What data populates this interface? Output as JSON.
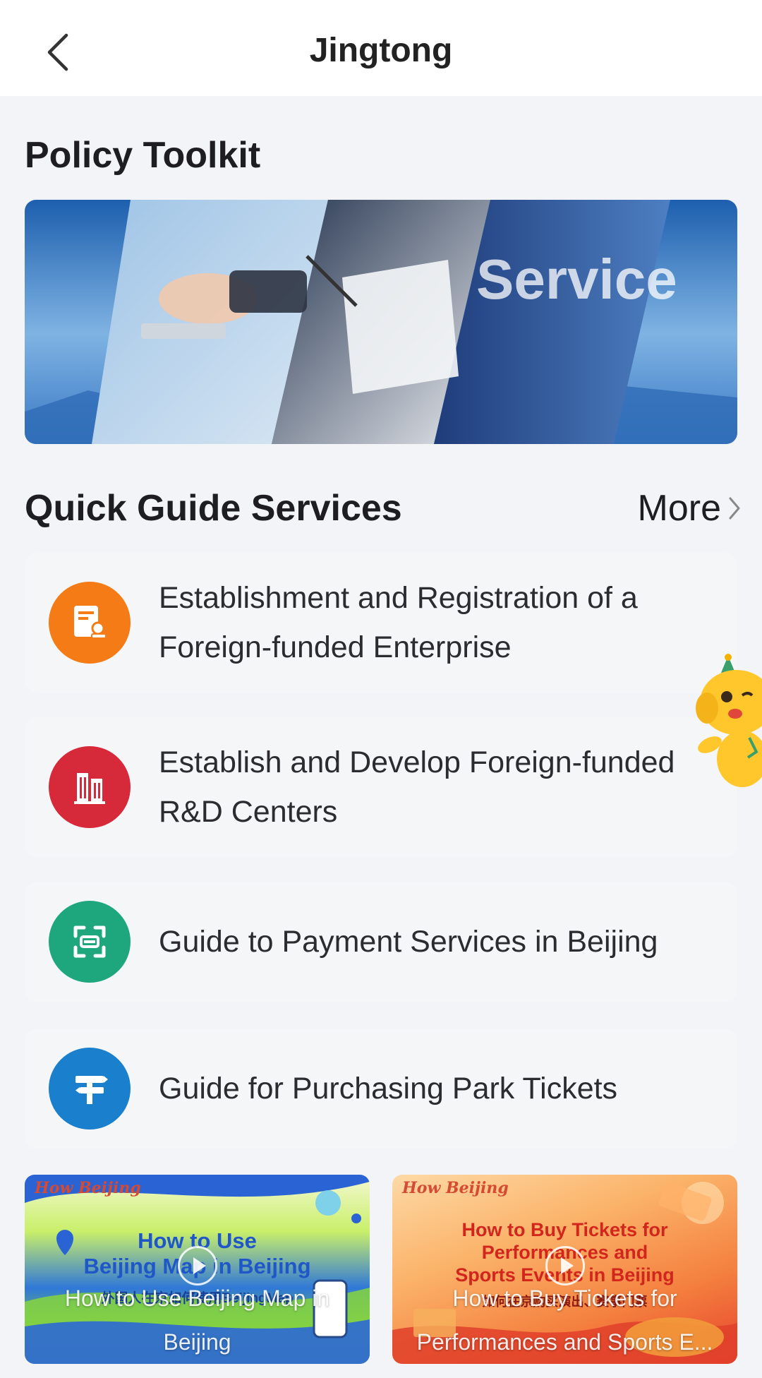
{
  "header": {
    "title": "Jingtong",
    "back_icon": "chevron-left-icon"
  },
  "policy_toolkit": {
    "title": "Policy Toolkit",
    "banner_text": "Service"
  },
  "quick_guide": {
    "title": "Quick Guide Services",
    "more_label": "More",
    "items": [
      {
        "label": "Establishment and Registration of a Foreign-funded Enterprise",
        "icon": "registration-stamp-icon",
        "color": "#f47b16"
      },
      {
        "label": "Establish and Develop Foreign-funded R&D Centers",
        "icon": "building-icon",
        "color": "#d6293a"
      },
      {
        "label": "Guide to Payment Services in Beijing",
        "icon": "scan-pay-icon",
        "color": "#1ea77d"
      },
      {
        "label": "Guide for Purchasing Park Tickets",
        "icon": "signpost-icon",
        "color": "#1a7fcc"
      }
    ]
  },
  "videos": [
    {
      "badge": "How Beijing",
      "title_line1": "How to Use",
      "title_line2": "Beijing Map in Beijing",
      "subtitle_cn": "外国人在京如何使用BeijingMap",
      "caption": "How to Use Beijing Map in Beijing"
    },
    {
      "badge": "How Beijing",
      "title_line1": "How to Buy Tickets for",
      "title_line2": "Performances and",
      "title_line3": "Sports Events in Beijing",
      "subtitle_cn": "如何在京购买演出、赛事门票",
      "caption": "How to Buy Tickets for Performances and Sports E..."
    }
  ],
  "colors": {
    "background": "#f3f4f7",
    "card": "#f5f6f8",
    "text": "#1e1e22"
  }
}
